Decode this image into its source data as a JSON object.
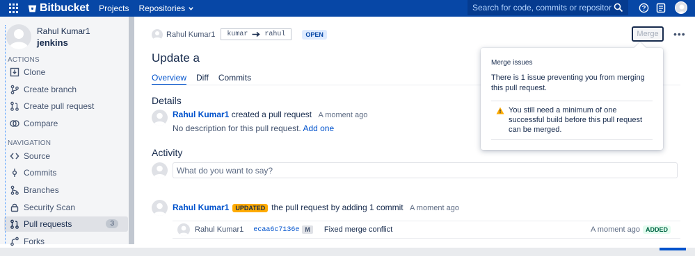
{
  "topbar": {
    "brand": "Bitbucket",
    "nav": [
      "Projects",
      "Repositories"
    ],
    "search_placeholder": "Search for code, commits or repositories...",
    "icons": [
      "app-switcher-icon",
      "search-icon",
      "help-icon",
      "notes-icon",
      "avatar"
    ]
  },
  "sidebar": {
    "user_name": "Rahul Kumar1",
    "repo_name": "jenkins",
    "actions_heading": "ACTIONS",
    "actions": [
      {
        "label": "Clone",
        "icon": "clone-icon"
      },
      {
        "label": "Create branch",
        "icon": "branch-icon"
      },
      {
        "label": "Create pull request",
        "icon": "pull-request-icon"
      },
      {
        "label": "Compare",
        "icon": "compare-icon"
      }
    ],
    "navigation_heading": "NAVIGATION",
    "navigation": [
      {
        "label": "Source",
        "icon": "source-icon"
      },
      {
        "label": "Commits",
        "icon": "commit-icon"
      },
      {
        "label": "Branches",
        "icon": "branches-icon"
      },
      {
        "label": "Security Scan",
        "icon": "lock-icon"
      },
      {
        "label": "Pull requests",
        "icon": "pull-request-icon",
        "badge": "3",
        "active": true
      },
      {
        "label": "Forks",
        "icon": "fork-icon"
      }
    ]
  },
  "pr": {
    "author": "Rahul Kumar1",
    "source_branch": "kumar",
    "target_branch": "rahul",
    "status": "OPEN",
    "merge_label": "Merge",
    "more_label": "•••",
    "title": "Update a",
    "tabs": [
      "Overview",
      "Diff",
      "Commits"
    ],
    "active_tab": "Overview"
  },
  "details": {
    "heading": "Details",
    "author": "Rahul Kumar1",
    "action": "created a pull request",
    "time": "A moment ago",
    "description": "No description for this pull request.",
    "add_link": "Add one"
  },
  "activity": {
    "heading": "Activity",
    "comment_placeholder": "What do you want to say?",
    "event": {
      "author": "Rahul Kumar1",
      "badge": "UPDATED",
      "text": "the pull request by adding 1 commit",
      "time": "A moment ago"
    },
    "commit": {
      "author": "Rahul Kumar1",
      "hash": "ecaa6c7136e",
      "tag": "M",
      "message": "Fixed merge conflict",
      "time": "A moment ago",
      "status": "ADDED"
    }
  },
  "merge_popup": {
    "title": "Merge issues",
    "summary": "There is 1 issue preventing you from merging this pull request.",
    "issue": "You still need a minimum of one successful build before this pull request can be merged."
  },
  "colors": {
    "topbar": "#0747a6",
    "link": "#0052cc",
    "updated": "#ffab00",
    "added_bg": "#e3fcef",
    "warning": "#ffab00"
  }
}
